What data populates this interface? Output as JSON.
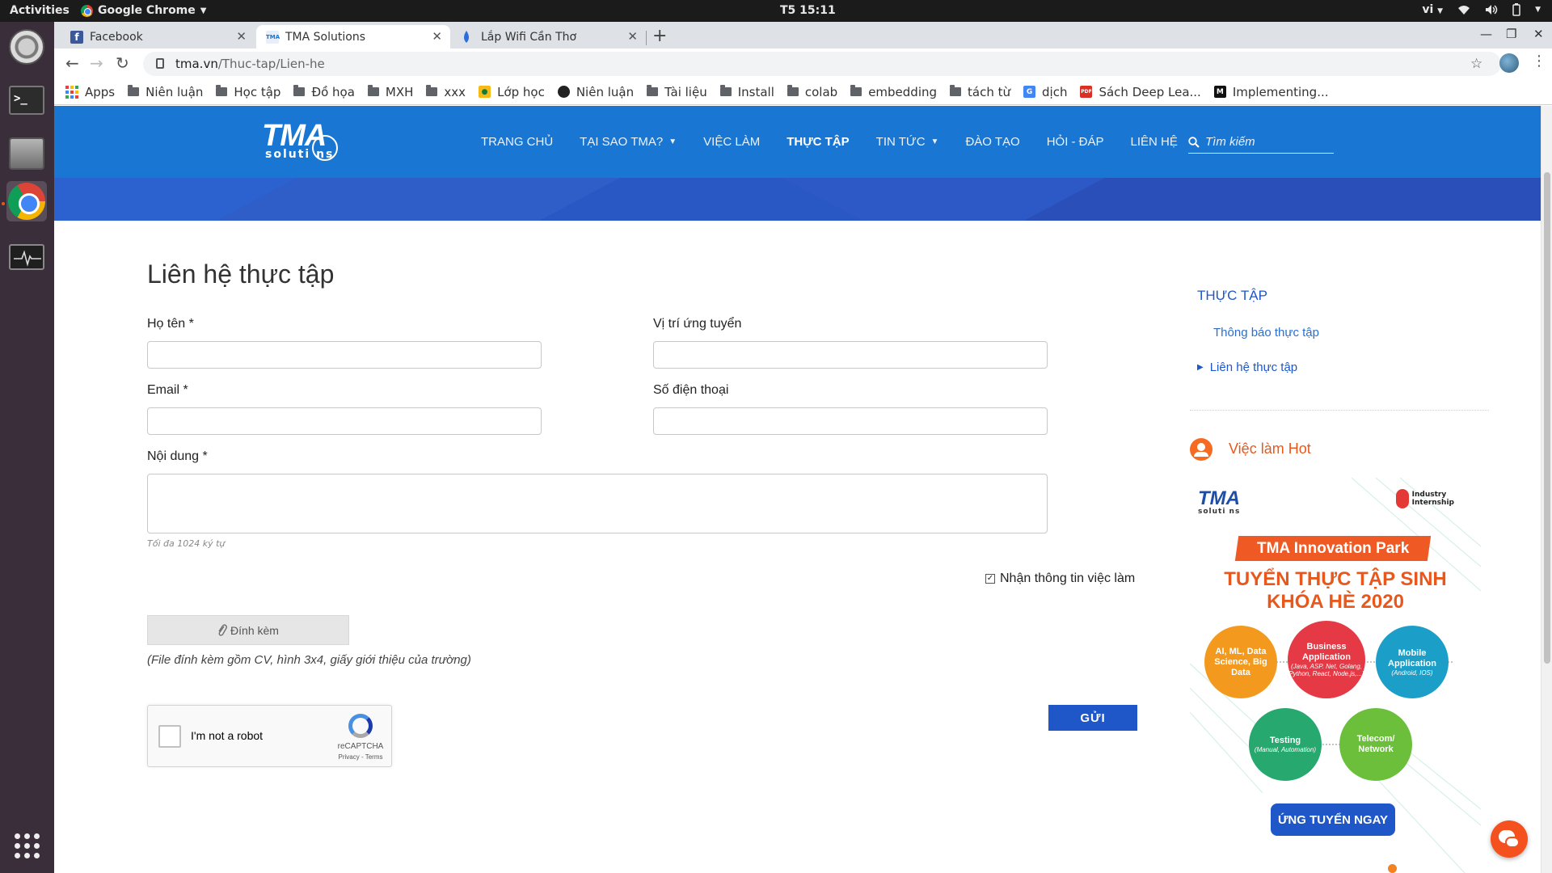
{
  "system": {
    "activities": "Activities",
    "app_menu": "Google Chrome",
    "clock": "T5 15:11",
    "input_method": "vi"
  },
  "browser": {
    "tabs": [
      {
        "title": "Facebook",
        "favicon_color": "#3b5998",
        "active": false
      },
      {
        "title": "TMA Solutions",
        "favicon_color": "#1976d2",
        "active": true
      },
      {
        "title": "Lắp Wifi Cần Thơ",
        "favicon_color": "#2a6fe0",
        "active": false
      }
    ],
    "url_domain": "tma.vn",
    "url_path": "/Thuc-tap/Lien-he",
    "bookmarks": [
      {
        "label": "Apps",
        "icon": "apps-grid-icon"
      },
      {
        "label": "Niên luận",
        "icon": "folder-icon"
      },
      {
        "label": "Học tập",
        "icon": "folder-icon"
      },
      {
        "label": "Đồ họa",
        "icon": "folder-icon"
      },
      {
        "label": "MXH",
        "icon": "folder-icon"
      },
      {
        "label": "xxx",
        "icon": "folder-icon"
      },
      {
        "label": "Lớp học",
        "icon": "classroom-icon"
      },
      {
        "label": "Niên luận",
        "icon": "github-icon"
      },
      {
        "label": "Tài liệu",
        "icon": "folder-icon"
      },
      {
        "label": "Install",
        "icon": "folder-icon"
      },
      {
        "label": "colab",
        "icon": "folder-icon"
      },
      {
        "label": "embedding",
        "icon": "folder-icon"
      },
      {
        "label": "tách từ",
        "icon": "folder-icon"
      },
      {
        "label": "dịch",
        "icon": "translate-icon"
      },
      {
        "label": "Sách Deep Lea...",
        "icon": "pdf-icon"
      },
      {
        "label": "Implementing...",
        "icon": "medium-icon"
      }
    ]
  },
  "site": {
    "logo_text": "TMA",
    "logo_sub": "soluti  ns",
    "nav": [
      {
        "label": "TRANG CHỦ",
        "has_caret": false,
        "current": false
      },
      {
        "label": "TẠI SAO TMA?",
        "has_caret": true,
        "current": false
      },
      {
        "label": "VIỆC LÀM",
        "has_caret": false,
        "current": false
      },
      {
        "label": "THỰC TẬP",
        "has_caret": false,
        "current": true
      },
      {
        "label": "TIN TỨC",
        "has_caret": true,
        "current": false
      },
      {
        "label": "ĐÀO TẠO",
        "has_caret": false,
        "current": false
      },
      {
        "label": "HỎI - ĐÁP",
        "has_caret": false,
        "current": false
      },
      {
        "label": "LIÊN HỆ",
        "has_caret": false,
        "current": false
      }
    ],
    "search_placeholder": "Tìm kiếm",
    "brand_color": "#1976d2"
  },
  "form": {
    "title": "Liên hệ thực tập",
    "name_label": "Họ tên *",
    "position_label": "Vị trí ứng tuyển",
    "email_label": "Email *",
    "phone_label": "Số điện thoại",
    "content_label": "Nội dung *",
    "content_hint": "Tối đa 1024 ký tự",
    "subscribe_label": "Nhận thông tin việc làm",
    "subscribe_checked": true,
    "attach_label": "Đính kèm",
    "attach_note": "(File đính kèm gồm CV, hình 3x4, giấy giới thiệu của trường)",
    "captcha_label": "I'm not a robot",
    "captcha_brand": "reCAPTCHA",
    "captcha_terms": "Privacy - Terms",
    "submit_label": "GỬI"
  },
  "sidebar": {
    "heading": "THỰC TẬP",
    "links": [
      "Thông báo thực tập",
      "Liên hệ thực tập"
    ],
    "hot_jobs_title": "Việc làm Hot"
  },
  "ad": {
    "logo": "TMA",
    "logo_sub": "soluti  ns",
    "partner": "Industry Internship",
    "park": "TMA Innovation Park",
    "headline1": "TUYỂN THỰC TẬP SINH",
    "headline2": "KHÓA HÈ 2020",
    "topics": [
      {
        "title": "AI, ML, Data Science, Big Data",
        "sub": "",
        "color": "#f39a1e"
      },
      {
        "title": "Business Application",
        "sub": "(Java, ASP. Net, Golang, Python, React, Node.js,...)",
        "color": "#e53945"
      },
      {
        "title": "Mobile Application",
        "sub": "(Android, IOS)",
        "color": "#1b9fc9"
      },
      {
        "title": "Testing",
        "sub": "(Manual, Automation)",
        "color": "#26a86e"
      },
      {
        "title": "Telecom/ Network",
        "sub": "",
        "color": "#6bbf3a"
      }
    ],
    "apply_label": "ỨNG TUYỂN NGAY"
  }
}
